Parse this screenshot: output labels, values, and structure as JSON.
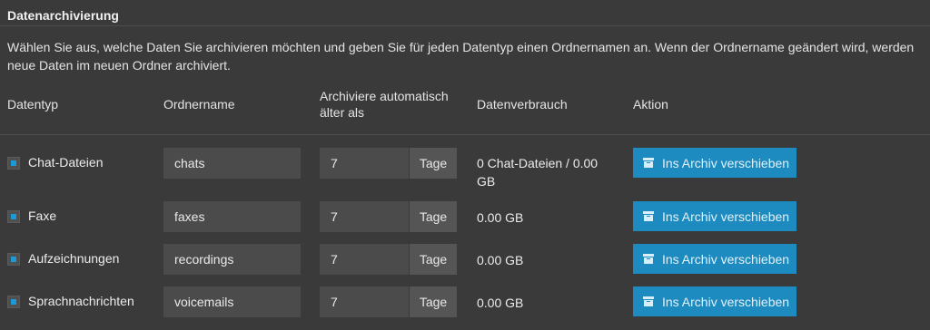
{
  "section": {
    "title": "Datenarchivierung",
    "description": "Wählen Sie aus, welche Daten Sie archivieren möchten und geben Sie für jeden Datentyp einen Ordnernamen an. Wenn der Ordnername geändert wird, werden neue Daten im neuen Ordner archiviert."
  },
  "columns": {
    "type": "Datentyp",
    "folder": "Ordnername",
    "archive_after_line1": "Archiviere automatisch",
    "archive_after_line2": "älter als",
    "usage": "Datenverbrauch",
    "action": "Aktion"
  },
  "rows": [
    {
      "checked": true,
      "label": "Chat-Dateien",
      "folder": "chats",
      "days": "7",
      "unit": "Tage",
      "usage": "0 Chat-Dateien / 0.00 GB",
      "button": "Ins Archiv verschieben"
    },
    {
      "checked": true,
      "label": "Faxe",
      "folder": "faxes",
      "days": "7",
      "unit": "Tage",
      "usage": "0.00 GB",
      "button": "Ins Archiv verschieben"
    },
    {
      "checked": true,
      "label": "Aufzeichnungen",
      "folder": "recordings",
      "days": "7",
      "unit": "Tage",
      "usage": "0.00 GB",
      "button": "Ins Archiv verschieben"
    },
    {
      "checked": true,
      "label": "Sprachnachrichten",
      "folder": "voicemails",
      "days": "7",
      "unit": "Tage",
      "usage": "0.00 GB",
      "button": "Ins Archiv verschieben"
    }
  ],
  "icons": {
    "checkbox": "checkbox-checked-icon",
    "archive": "archive-box-icon"
  },
  "colors": {
    "accent": "#1d8bbf",
    "checkbox": "#1a9ad6",
    "background": "#3a3a3a"
  }
}
